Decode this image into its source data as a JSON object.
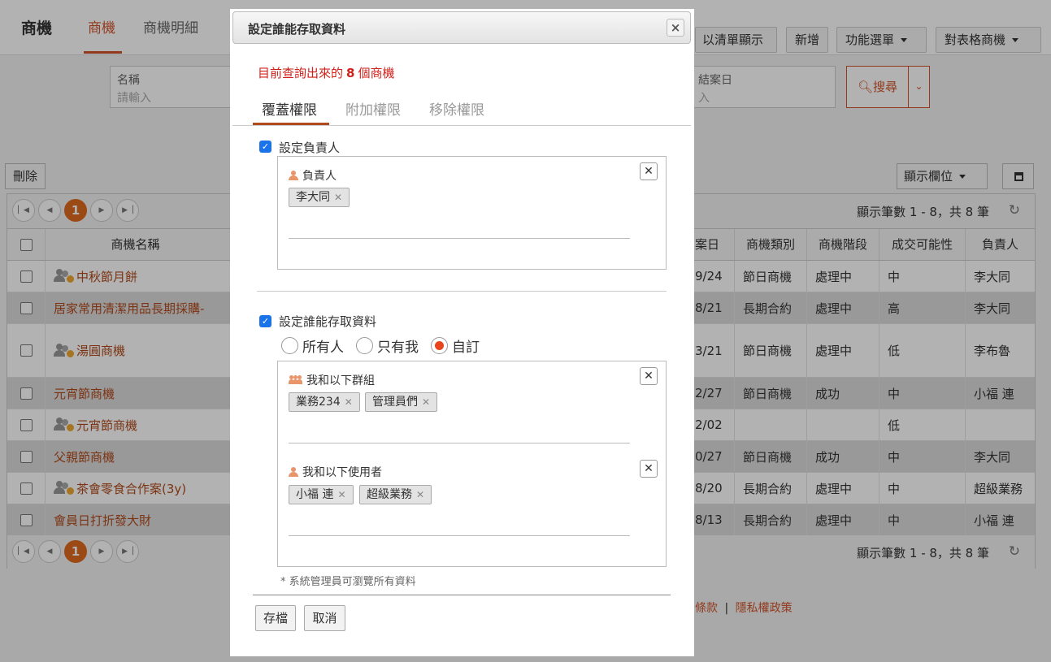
{
  "app": {
    "brand": "商機",
    "tabs": [
      "商機",
      "商機明細"
    ],
    "header_buttons": [
      "以清單顯示",
      "新增",
      "功能選單",
      "對表格商機"
    ]
  },
  "filters": {
    "name_label": "名稱",
    "name_placeholder": "請輸入",
    "close_date_label": "結案日",
    "close_date_placeholder": "入",
    "search_label": "搜尋"
  },
  "toolbar": {
    "delete_label": "刪除",
    "show_columns_label": "顯示欄位"
  },
  "pager": {
    "current_page": "1",
    "info": "顯示筆數 1 - 8，共 8 筆"
  },
  "table": {
    "columns": [
      "商機名稱",
      "案日",
      "商機類別",
      "商機階段",
      "成交可能性",
      "負責人"
    ],
    "rows": [
      {
        "name": "中秋節月餅",
        "icon": true,
        "date": "9/24",
        "type": "節日商機",
        "stage": "處理中",
        "prob": "中",
        "owner": "李大同"
      },
      {
        "name": "居家常用清潔用品長期採購-",
        "icon": false,
        "date": "8/21",
        "type": "長期合約",
        "stage": "處理中",
        "prob": "高",
        "owner": "李大同"
      },
      {
        "name": "湯圓商機",
        "icon": true,
        "date": "3/21",
        "type": "節日商機",
        "stage": "處理中",
        "prob": "低",
        "owner": "李布魯"
      },
      {
        "name": "元宵節商機",
        "icon": false,
        "date": "2/27",
        "type": "節日商機",
        "stage": "成功",
        "prob": "中",
        "owner": "小福 連"
      },
      {
        "name": "元宵節商機",
        "icon": true,
        "date": "2/02",
        "type": "",
        "stage": "",
        "prob": "低",
        "owner": ""
      },
      {
        "name": "父親節商機",
        "icon": false,
        "date": "0/27",
        "type": "節日商機",
        "stage": "成功",
        "prob": "中",
        "owner": "李大同"
      },
      {
        "name": "茶會零食合作案(3y)",
        "icon": true,
        "date": "8/20",
        "type": "長期合約",
        "stage": "處理中",
        "prob": "中",
        "owner": "超級業務"
      },
      {
        "name": "會員日打折發大財",
        "icon": false,
        "date": "8/13",
        "type": "長期合約",
        "stage": "處理中",
        "prob": "中",
        "owner": "小福 連"
      }
    ]
  },
  "footer": {
    "terms": "條款",
    "separator": "|",
    "privacy": "隱私權政策"
  },
  "modal": {
    "title": "設定誰能存取資料",
    "close": "×",
    "query_prefix": "目前查詢出來的",
    "query_count": "8",
    "query_suffix": "個商機",
    "tabs": [
      "覆蓋權限",
      "附加權限",
      "移除權限"
    ],
    "owner_section": {
      "checkbox_label": "設定負責人",
      "checked": true,
      "field_label": "負責人",
      "chips": [
        "李大同"
      ]
    },
    "access_section": {
      "checkbox_label": "設定誰能存取資料",
      "checked": true,
      "radio_options": [
        "所有人",
        "只有我",
        "自訂"
      ],
      "selected": "自訂",
      "groups_label": "我和以下群組",
      "group_chips": [
        "業務234",
        "管理員們"
      ],
      "users_label": "我和以下使用者",
      "user_chips": [
        "小福 連",
        "超級業務"
      ]
    },
    "note": "*  系統管理員可瀏覽所有資料",
    "save_label": "存檔",
    "cancel_label": "取消"
  },
  "colors": {
    "accent": "#d2542a",
    "highlight_red": "#d0201a",
    "radio_selected": "#e8451f",
    "checkbox_blue": "#1a73e8"
  }
}
